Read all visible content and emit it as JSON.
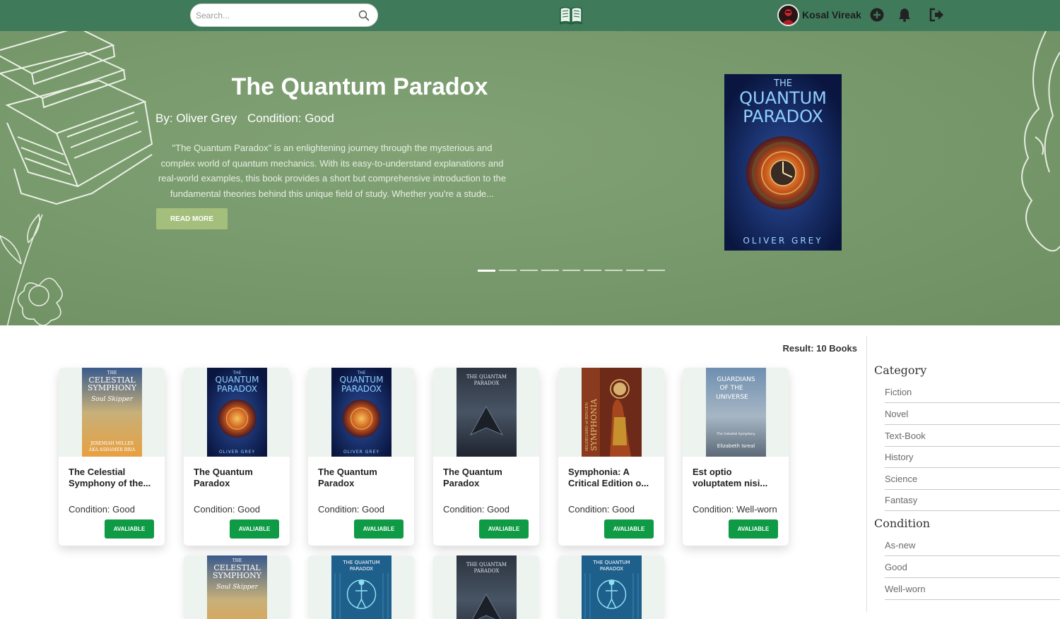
{
  "nav": {
    "search_placeholder": "Search...",
    "user_name": "Kosal Vireak",
    "icons": [
      "search-icon",
      "book-logo-icon",
      "add-icon",
      "bell-icon",
      "logout-icon"
    ]
  },
  "hero": {
    "title": "The Quantum Paradox",
    "author": "By: Oliver Grey",
    "condition": "Condition: Good",
    "description": "\"The Quantum Paradox\" is an enlightening journey through the mysterious and complex world of quantum mechanics. With its easy-to-understand explanations and real-world examples, this book provides a short but comprehensive introduction to the fundamental theories behind this unique field of study. Whether you're a stude...",
    "read_more": "READ MORE",
    "cover_text": {
      "top": "THE",
      "line1": "QUANTUM",
      "line2": "PARADOX",
      "author": "OLIVER GREY"
    },
    "slide_count": 9,
    "active_slide": 1
  },
  "result": "Result: 10 Books",
  "books": [
    {
      "title": "The Celestial Symphony of the...",
      "condition": "Condition: Good",
      "status": "AVALIABLE",
      "cover": "celestial"
    },
    {
      "title": "The Quantum Paradox",
      "condition": "Condition: Good",
      "status": "AVALIABLE",
      "cover": "quantum"
    },
    {
      "title": "The Quantum Paradox",
      "condition": "Condition: Good",
      "status": "AVALIABLE",
      "cover": "quantum"
    },
    {
      "title": "The Quantum Paradox",
      "condition": "Condition: Good",
      "status": "AVALIABLE",
      "cover": "quantam-dark"
    },
    {
      "title": "Symphonia: A Critical Edition o...",
      "condition": "Condition: Good",
      "status": "AVALIABLE",
      "cover": "symphonia"
    },
    {
      "title": "Est optio voluptatem nisi...",
      "condition": "Condition: Well-worn",
      "status": "AVALIABLE",
      "cover": "guardians"
    }
  ],
  "cover_texts": {
    "celestial": {
      "l1": "THE",
      "l2": "CELESTIAL",
      "l3": "SYMPHONY",
      "script": "Soul Skipper",
      "author1": "JEREMIAH MILLER",
      "author2": "AKA ASHAMER BRIA"
    },
    "quantum": {
      "l1": "THE",
      "l2": "QUANTUM",
      "l3": "PARADOX",
      "author": "OLIVER GREY"
    },
    "quantam_dark": {
      "l1": "THE QUANTAM",
      "l2": "PARADOX"
    },
    "symphonia": {
      "l1": "HILDEGARD of BINGEN",
      "l2": "SYMPHONIA"
    },
    "guardians": {
      "l1": "GUARDIANS",
      "l2": "OF THE",
      "l3": "UNIVERSE",
      "sub": "The Celestial Symphony",
      "author": "Elizabeth Isreal"
    },
    "quantum_blue": {
      "l1": "THE QUANTUM",
      "l2": "PARADOX"
    }
  },
  "sidebar": {
    "category_heading": "Category",
    "categories": [
      "Fiction",
      "Novel",
      "Text-Book",
      "History",
      "Science",
      "Fantasy"
    ],
    "condition_heading": "Condition",
    "conditions": [
      "As-new",
      "Good",
      "Well-worn"
    ]
  },
  "colors": {
    "navbar": "#3f7a5a",
    "hero": "#789a6c",
    "status_button": "#0f9a45",
    "read_more": "#a4bf7c"
  }
}
